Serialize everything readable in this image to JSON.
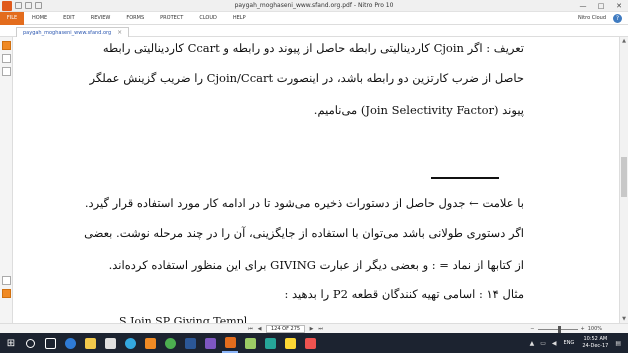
{
  "window": {
    "title": "paygah_moghaseni_www.sfand.org.pdf - Nitro Pro 10",
    "minimize": "—",
    "maximize": "□",
    "close": "✕"
  },
  "ribbon": {
    "file": "FILE",
    "tabs": [
      "HOME",
      "EDIT",
      "REVIEW",
      "FORMS",
      "PROTECT",
      "CLOUD",
      "HELP"
    ],
    "user": "Nitro Cloud",
    "help": "?"
  },
  "doc_tab": {
    "label": "paygah_moghaseni_www.sfand.org",
    "close": "×"
  },
  "page": {
    "lines_top": [
      "تعریف : اگر Cjoin کاردینالیتی رابطه حاصل از پیوند دو رابطه و Ccart کاردینالیتی رابطه",
      "حاصل از ضرب کارتزین دو رابطه باشد، در اینصورت Cjoin/Ccart را ضریب گزینش عملگر",
      "پیوند (Join Selectivity Factor) می‌نامیم."
    ],
    "lines_bottom": [
      "با علامت ← جدول حاصل از دستورات ذخیره می‌شود تا در ادامه کار مورد استفاده قرار گیرد.",
      "اگر دستوری طولانی باشد می‌توان با استفاده از جایگزینی، آن را در چند مرحله نوشت. بعضی",
      "از کتابها از نماد = : و بعضی دیگر از عبارت GIVING برای این منظور استفاده کرده‌اند.",
      "مثال ۱۴ : اسامی تهیه کنندگان قطعه P2 را بدهید :"
    ],
    "cut_line": "S Join SP Giving Templ"
  },
  "statusbar": {
    "first": "⏮",
    "prev": "◀",
    "page_indicator": "124 OF 275",
    "next": "▶",
    "last": "⏭",
    "zoom_out": "−",
    "zoom_in": "+",
    "zoom_level": "100%"
  },
  "taskbar": {
    "start": "⊞",
    "lang": "ENG",
    "time": "10:52 AM",
    "date": "24-Dec-17"
  }
}
